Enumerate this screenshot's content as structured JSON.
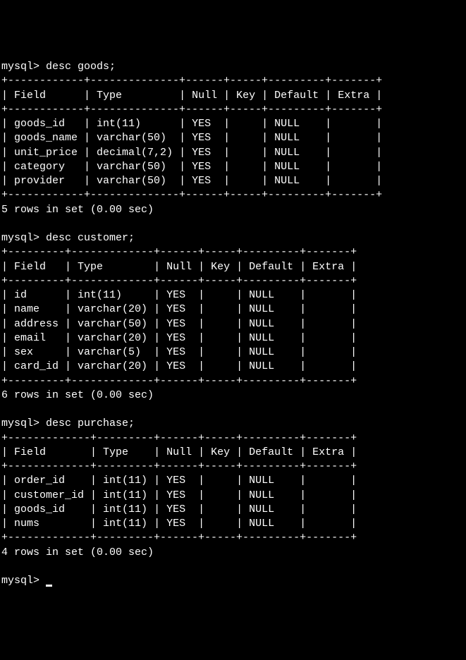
{
  "prompt": "mysql>",
  "cursor": "_",
  "commands": [
    {
      "cmd": "desc goods;",
      "headers": [
        "Field",
        "Type",
        "Null",
        "Key",
        "Default",
        "Extra"
      ],
      "rows": [
        {
          "field": "goods_id",
          "type": "int(11)",
          "null": "YES",
          "key": "",
          "default": "NULL",
          "extra": ""
        },
        {
          "field": "goods_name",
          "type": "varchar(50)",
          "null": "YES",
          "key": "",
          "default": "NULL",
          "extra": ""
        },
        {
          "field": "unit_price",
          "type": "decimal(7,2)",
          "null": "YES",
          "key": "",
          "default": "NULL",
          "extra": ""
        },
        {
          "field": "category",
          "type": "varchar(50)",
          "null": "YES",
          "key": "",
          "default": "NULL",
          "extra": ""
        },
        {
          "field": "provider",
          "type": "varchar(50)",
          "null": "YES",
          "key": "",
          "default": "NULL",
          "extra": ""
        }
      ],
      "summary": "5 rows in set (0.00 sec)"
    },
    {
      "cmd": "desc customer;",
      "headers": [
        "Field",
        "Type",
        "Null",
        "Key",
        "Default",
        "Extra"
      ],
      "rows": [
        {
          "field": "id",
          "type": "int(11)",
          "null": "YES",
          "key": "",
          "default": "NULL",
          "extra": ""
        },
        {
          "field": "name",
          "type": "varchar(20)",
          "null": "YES",
          "key": "",
          "default": "NULL",
          "extra": ""
        },
        {
          "field": "address",
          "type": "varchar(50)",
          "null": "YES",
          "key": "",
          "default": "NULL",
          "extra": ""
        },
        {
          "field": "email",
          "type": "varchar(20)",
          "null": "YES",
          "key": "",
          "default": "NULL",
          "extra": ""
        },
        {
          "field": "sex",
          "type": "varchar(5)",
          "null": "YES",
          "key": "",
          "default": "NULL",
          "extra": ""
        },
        {
          "field": "card_id",
          "type": "varchar(20)",
          "null": "YES",
          "key": "",
          "default": "NULL",
          "extra": ""
        }
      ],
      "summary": "6 rows in set (0.00 sec)"
    },
    {
      "cmd": "desc purchase;",
      "headers": [
        "Field",
        "Type",
        "Null",
        "Key",
        "Default",
        "Extra"
      ],
      "rows": [
        {
          "field": "order_id",
          "type": "int(11)",
          "null": "YES",
          "key": "",
          "default": "NULL",
          "extra": ""
        },
        {
          "field": "customer_id",
          "type": "int(11)",
          "null": "YES",
          "key": "",
          "default": "NULL",
          "extra": ""
        },
        {
          "field": "goods_id",
          "type": "int(11)",
          "null": "YES",
          "key": "",
          "default": "NULL",
          "extra": ""
        },
        {
          "field": "nums",
          "type": "int(11)",
          "null": "YES",
          "key": "",
          "default": "NULL",
          "extra": ""
        }
      ],
      "summary": "4 rows in set (0.00 sec)"
    }
  ],
  "chart_data": [
    {
      "type": "table",
      "title": "desc goods",
      "columns": [
        "Field",
        "Type",
        "Null",
        "Key",
        "Default",
        "Extra"
      ],
      "data": [
        [
          "goods_id",
          "int(11)",
          "YES",
          "",
          "NULL",
          ""
        ],
        [
          "goods_name",
          "varchar(50)",
          "YES",
          "",
          "NULL",
          ""
        ],
        [
          "unit_price",
          "decimal(7,2)",
          "YES",
          "",
          "NULL",
          ""
        ],
        [
          "category",
          "varchar(50)",
          "YES",
          "",
          "NULL",
          ""
        ],
        [
          "provider",
          "varchar(50)",
          "YES",
          "",
          "NULL",
          ""
        ]
      ]
    },
    {
      "type": "table",
      "title": "desc customer",
      "columns": [
        "Field",
        "Type",
        "Null",
        "Key",
        "Default",
        "Extra"
      ],
      "data": [
        [
          "id",
          "int(11)",
          "YES",
          "",
          "NULL",
          ""
        ],
        [
          "name",
          "varchar(20)",
          "YES",
          "",
          "NULL",
          ""
        ],
        [
          "address",
          "varchar(50)",
          "YES",
          "",
          "NULL",
          ""
        ],
        [
          "email",
          "varchar(20)",
          "YES",
          "",
          "NULL",
          ""
        ],
        [
          "sex",
          "varchar(5)",
          "YES",
          "",
          "NULL",
          ""
        ],
        [
          "card_id",
          "varchar(20)",
          "YES",
          "",
          "NULL",
          ""
        ]
      ]
    },
    {
      "type": "table",
      "title": "desc purchase",
      "columns": [
        "Field",
        "Type",
        "Null",
        "Key",
        "Default",
        "Extra"
      ],
      "data": [
        [
          "order_id",
          "int(11)",
          "YES",
          "",
          "NULL",
          ""
        ],
        [
          "customer_id",
          "int(11)",
          "YES",
          "",
          "NULL",
          ""
        ],
        [
          "goods_id",
          "int(11)",
          "YES",
          "",
          "NULL",
          ""
        ],
        [
          "nums",
          "int(11)",
          "YES",
          "",
          "NULL",
          ""
        ]
      ]
    }
  ]
}
